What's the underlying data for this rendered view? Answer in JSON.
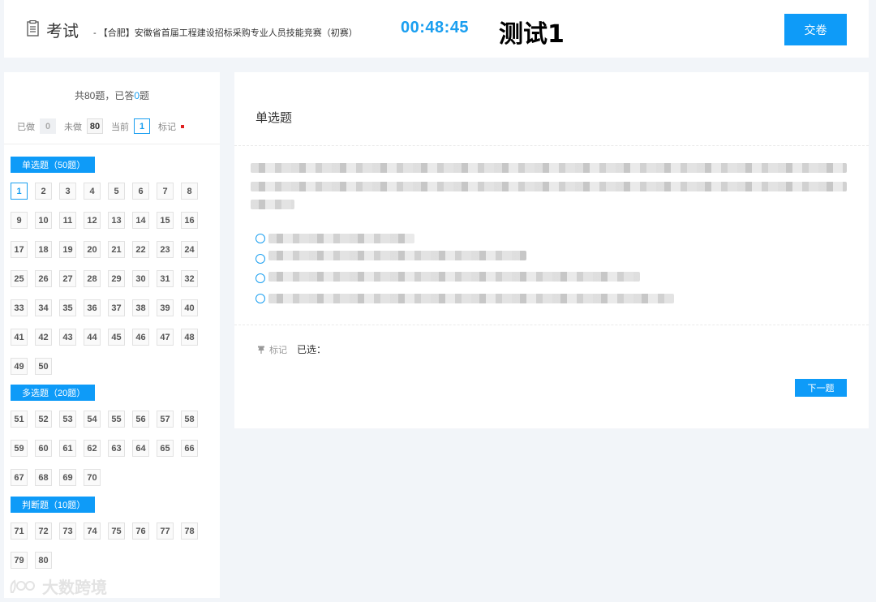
{
  "header": {
    "title": "考试",
    "subtitle": "- 【合肥】安徽省首届工程建设招标采购专业人员技能竞赛（初赛）",
    "timer": "00:48:45",
    "test_name": "测试1",
    "submit_label": "交卷"
  },
  "sidebar": {
    "summary_prefix": "共80题，已答",
    "answered_count": "0",
    "summary_suffix": "题",
    "legend": {
      "done_label": "已做",
      "done_count": "0",
      "todo_label": "未做",
      "todo_count": "80",
      "current_label": "当前",
      "current_num": "1",
      "mark_label": "标记"
    },
    "sections": [
      {
        "label": "单选题（50题）",
        "start": 1,
        "end": 50
      },
      {
        "label": "多选题（20题）",
        "start": 51,
        "end": 70
      },
      {
        "label": "判断题（10题）",
        "start": 71,
        "end": 80
      }
    ],
    "current_question": 1
  },
  "main": {
    "question_type": "单选题",
    "question_text": "(blurred)",
    "options": [
      "(blurred)",
      "(blurred)",
      "(blurred)",
      "(blurred)"
    ],
    "mark_label": "标记",
    "selected_label": "已选：",
    "next_label": "下一题"
  },
  "watermark": {
    "text": "大数跨境"
  },
  "colors": {
    "accent": "#0e9bf8",
    "timer": "#1a9ff0",
    "mark": "#e02020"
  }
}
